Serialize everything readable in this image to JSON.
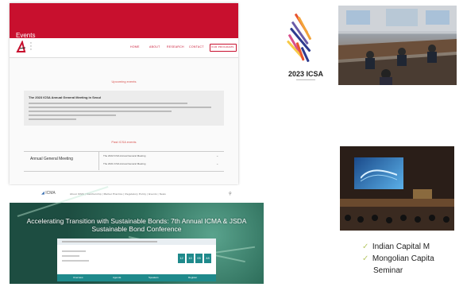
{
  "site1": {
    "banner_title": "Events",
    "nav_items": [
      "HOME",
      "ABOUT",
      "RESEARCH",
      "CONTACT"
    ],
    "nav_button": "OUR PROGRAMS",
    "upcoming_heading": "Upcoming events",
    "upcoming_event_title": "The 2023 ICSA Annual General Meeting in Seoul",
    "past_heading": "Past ICSA events",
    "past_category": "Annual General Meeting",
    "past_rows": [
      "The 2022 ICSA Annual General Meeting",
      "The 2021 ICSA Annual General Meeting"
    ]
  },
  "site2": {
    "header_logo": "ICMA",
    "nav_text": "About ICMA  |  Membership  |  Market Practice  |  Regulatory Policy  |  Events  |  News",
    "headline": "Accelerating Transition with Sustainable Bonds: 7th Annual ICMA & JSDA Sustainable Bond Conference",
    "countdown": [
      "12",
      "10",
      "05",
      "48"
    ],
    "tabs": [
      "Overview",
      "Agenda",
      "Speakers",
      "Register"
    ]
  },
  "icsa_logo": {
    "label": "2023 ICSA",
    "stripe_colors": [
      "#e8542f",
      "#f2a33a",
      "#6a5aa8",
      "#2e3b8f",
      "#d94f8c",
      "#f7c948"
    ]
  },
  "bullets": [
    "Indian Capital  M",
    "Mongolian Capita",
    "Seminar"
  ]
}
